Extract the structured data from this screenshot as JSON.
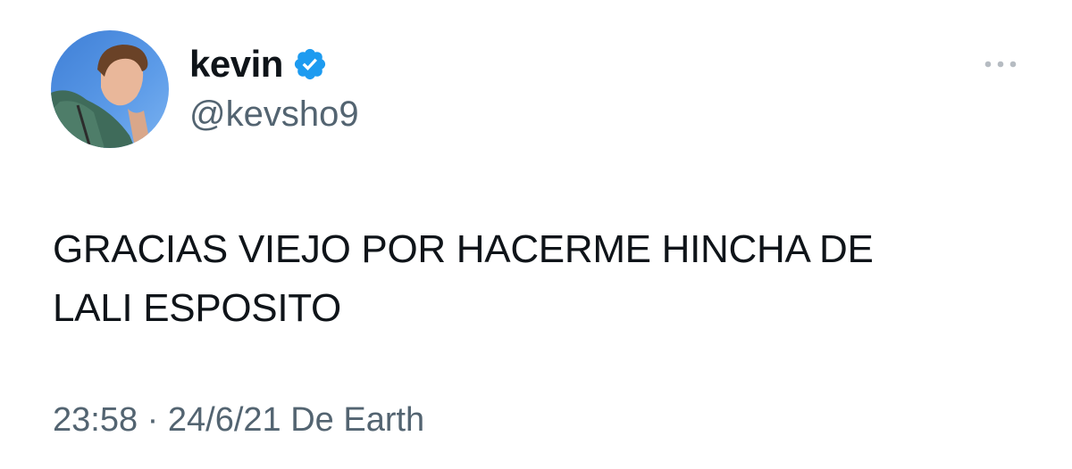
{
  "author": {
    "display_name": "kevin",
    "handle": "@kevsho9",
    "verified": true
  },
  "tweet": {
    "text_line_1": "GRACIAS VIEJO POR HACERME HINCHA DE",
    "text_line_2": "LALI ESPOSITO"
  },
  "meta": {
    "time": "23:58",
    "separator": "·",
    "date": "24/6/21",
    "source": "De Earth"
  },
  "icons": {
    "verified": "verified-badge-icon",
    "more": "more-options-icon"
  },
  "colors": {
    "text": "#0f1419",
    "secondary": "#536471",
    "verified_blue": "#1d9bf0",
    "background": "#ffffff"
  }
}
